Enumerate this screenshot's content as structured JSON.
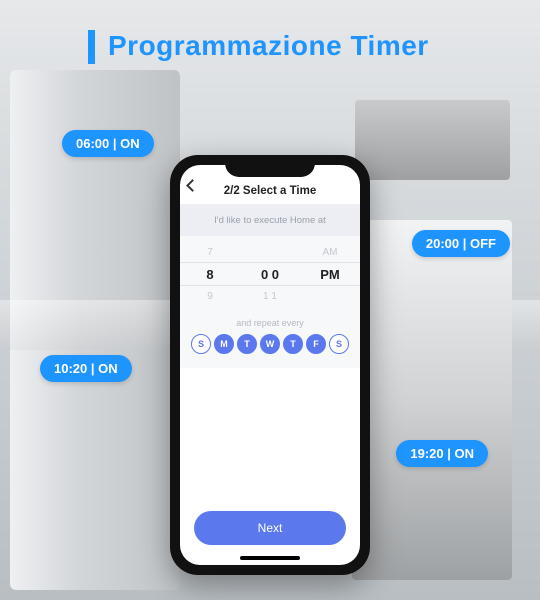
{
  "banner": {
    "title": "Programmazione Timer"
  },
  "callouts": {
    "c1": "06:00 | ON",
    "c2": "20:00 | OFF",
    "c3": "10:20 | ON",
    "c4": "19:20 | ON"
  },
  "app": {
    "nav_title": "2/2 Select a Time",
    "subtitle": "I'd like to execute Home at",
    "picker": {
      "above": {
        "h": "7",
        "m": "",
        "ampm": "AM"
      },
      "active": {
        "h": "8",
        "m": "0 0",
        "ampm": "PM"
      },
      "below": {
        "h": "9",
        "m": "1 1",
        "ampm": ""
      }
    },
    "repeat_label": "and repeat every",
    "days": [
      {
        "label": "S",
        "selected": false
      },
      {
        "label": "M",
        "selected": true
      },
      {
        "label": "T",
        "selected": true
      },
      {
        "label": "W",
        "selected": true
      },
      {
        "label": "T",
        "selected": true
      },
      {
        "label": "F",
        "selected": true
      },
      {
        "label": "S",
        "selected": false
      }
    ],
    "next_label": "Next"
  }
}
